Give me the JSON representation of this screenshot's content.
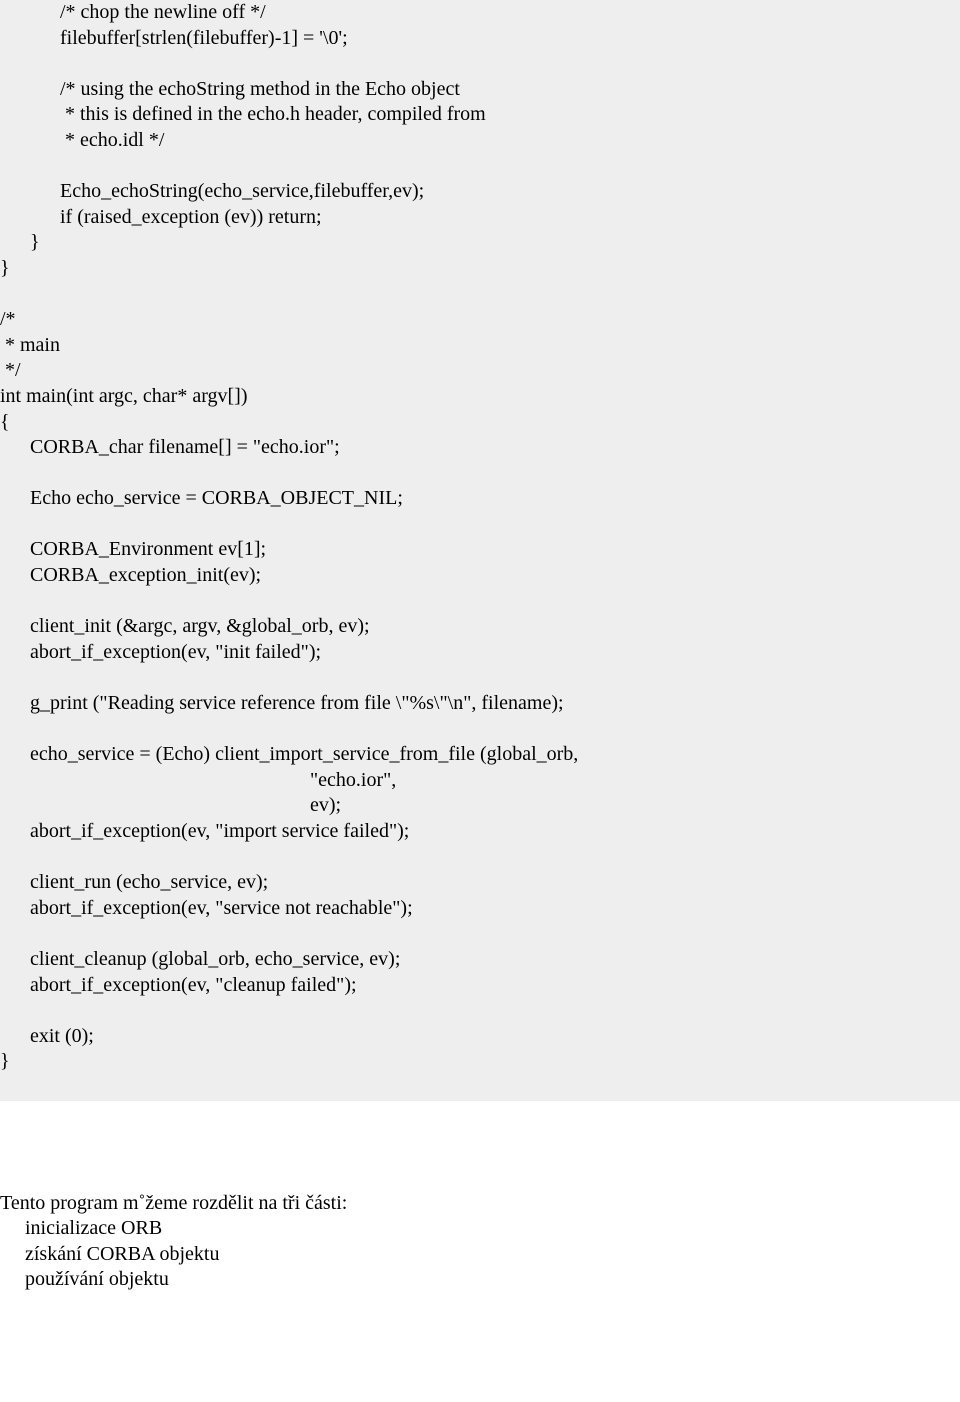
{
  "code": "            /* chop the newline off */\n            filebuffer[strlen(filebuffer)-1] = '\\0';\n\n            /* using the echoString method in the Echo object\n             * this is defined in the echo.h header, compiled from\n             * echo.idl */\n\n            Echo_echoString(echo_service,filebuffer,ev);\n            if (raised_exception (ev)) return;\n      }\n}\n\n/*\n * main\n */\nint main(int argc, char* argv[])\n{\n      CORBA_char filename[] = \"echo.ior\";\n\n      Echo echo_service = CORBA_OBJECT_NIL;\n\n      CORBA_Environment ev[1];\n      CORBA_exception_init(ev);\n\n      client_init (&argc, argv, &global_orb, ev);\n      abort_if_exception(ev, \"init failed\");\n\n      g_print (\"Reading service reference from file \\\"%s\\\"\\n\", filename);\n\n      echo_service = (Echo) client_import_service_from_file (global_orb,\n                                                              \"echo.ior\",\n                                                              ev);\n      abort_if_exception(ev, \"import service failed\");\n\n      client_run (echo_service, ev);\n      abort_if_exception(ev, \"service not reachable\");\n\n      client_cleanup (global_orb, echo_service, ev);\n      abort_if_exception(ev, \"cleanup failed\");\n\n      exit (0);\n}\n\n",
  "paragraph": "Tento program m˚žeme rozdělit na tři části:\n     inicializace ORB\n     získání CORBA objektu\n     používání objektu"
}
